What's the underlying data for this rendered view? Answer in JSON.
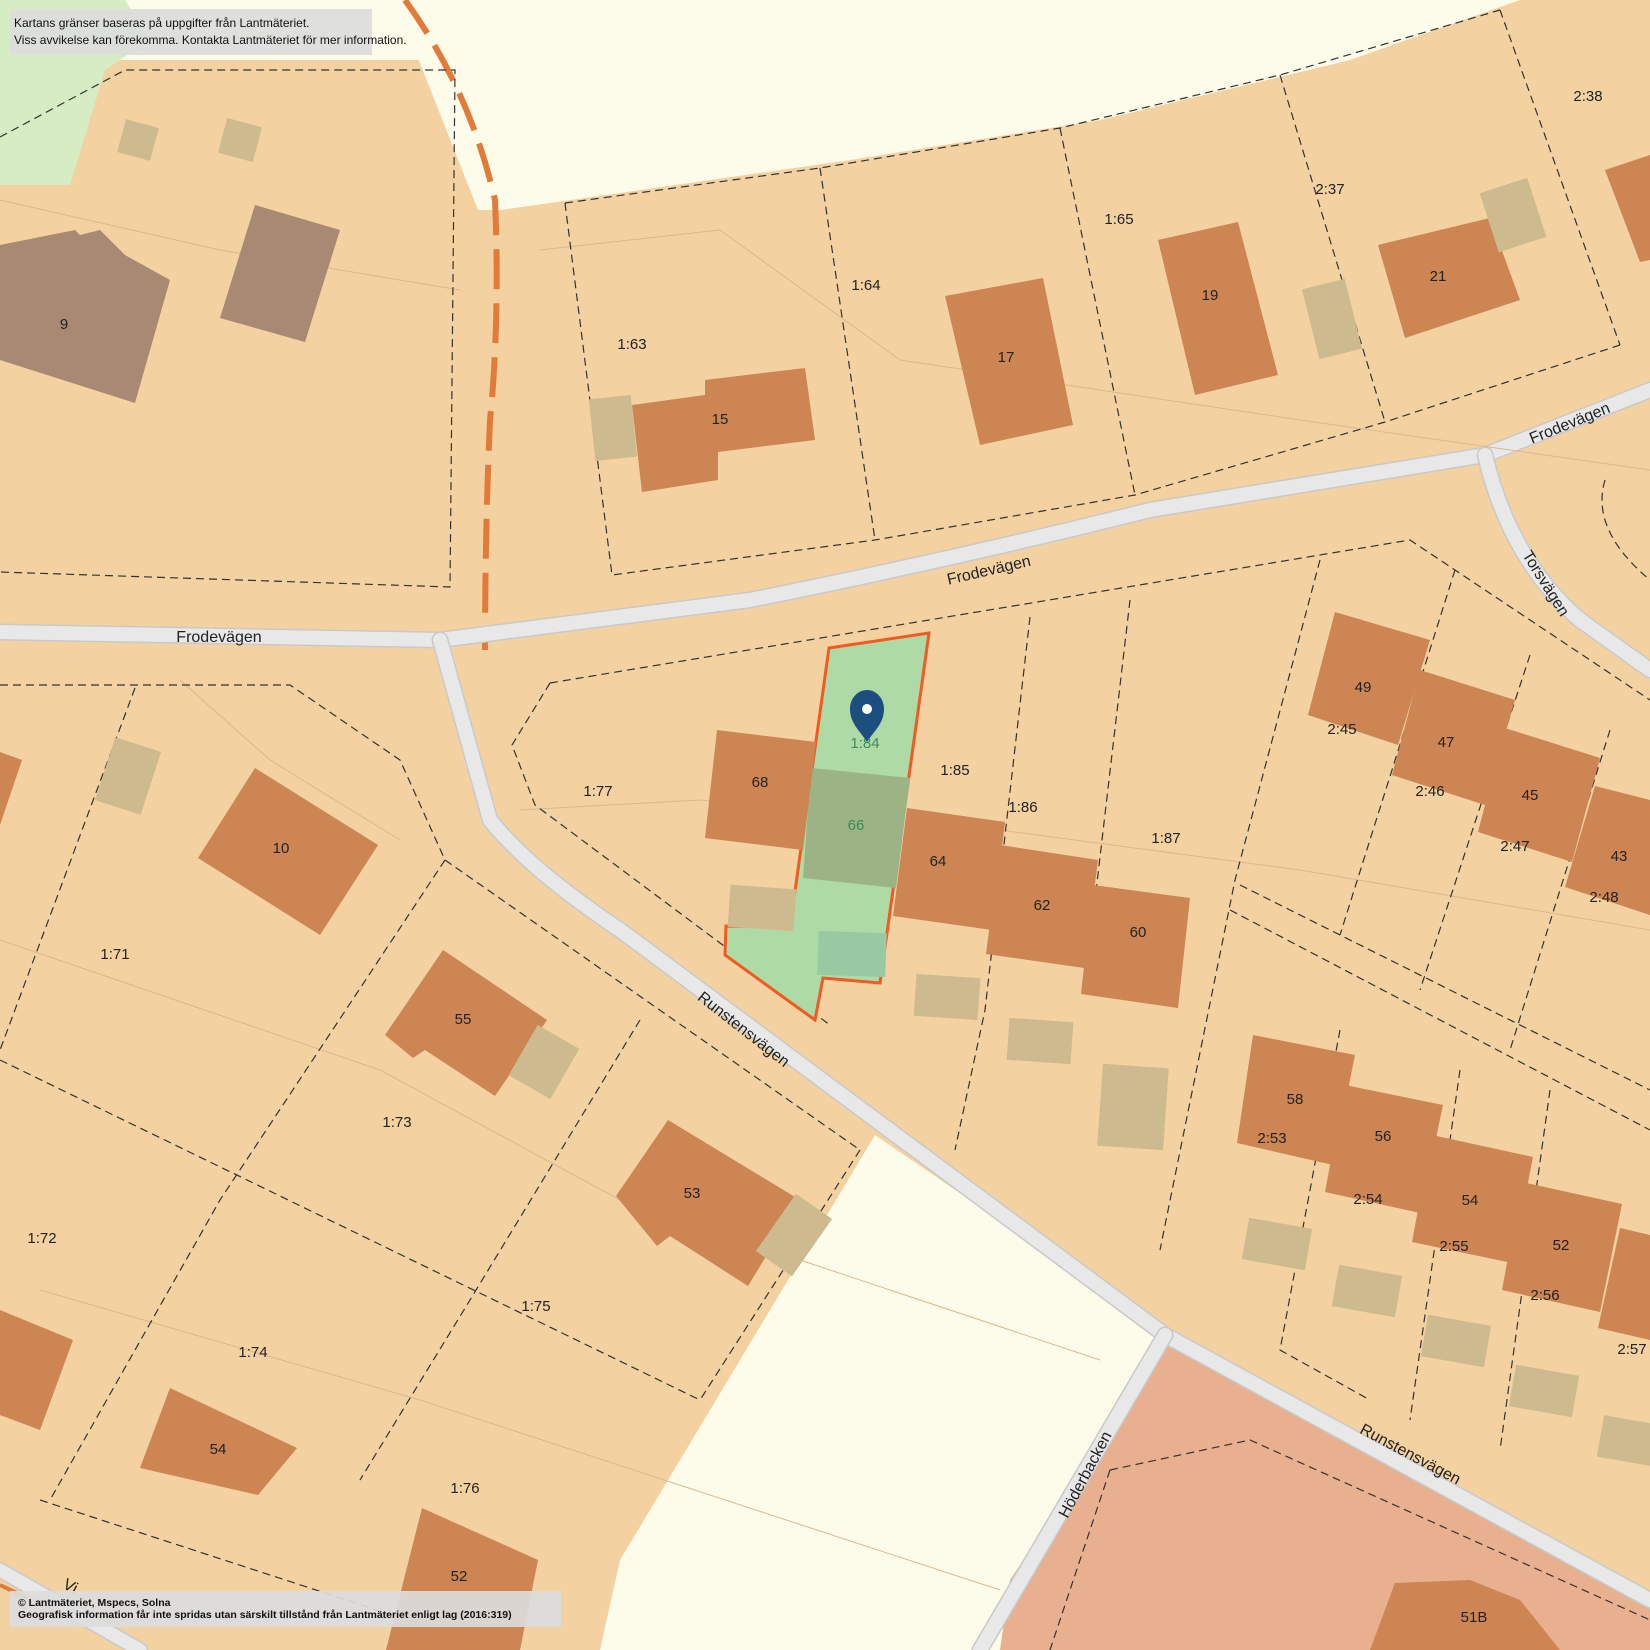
{
  "notices": {
    "top_line1": "Kartans gränser baseras på uppgifter från Lantmäteriet.",
    "top_line2": "Viss avvikelse kan förekomma. Kontakta Lantmäteriet för mer information.",
    "copyright_line1": "© Lantmäteriet, Mspecs, Solna",
    "copyright_line2": "Geografisk information får inte spridas utan särskilt tillstånd från Lantmäteriet enligt lag (2016:319)"
  },
  "streets": {
    "frodevagen_west": "Frodevägen",
    "frodevagen_mid": "Frodevägen",
    "frodevagen_east": "Frodevägen",
    "torsvagen": "Torsvägen",
    "runstensvagen_mid": "Runstensvägen",
    "runstensvagen_east": "Runstensvägen",
    "hoderbacken": "Höderbacken",
    "partial_street": "Vi"
  },
  "selected_parcel": {
    "parcel_id": "1:84",
    "house_number": "66",
    "highlight_color": "#f15a22",
    "marker_color": "#1c4e80",
    "marker_icon": "map-pin-icon"
  },
  "parcels": {
    "p_1_63": "1:63",
    "p_1_64": "1:64",
    "p_1_65": "1:65",
    "p_2_37": "2:37",
    "p_2_38": "2:38",
    "p_1_77": "1:77",
    "p_1_85": "1:85",
    "p_1_86": "1:86",
    "p_1_87": "1:87",
    "p_2_45": "2:45",
    "p_2_46": "2:46",
    "p_2_47": "2:47",
    "p_2_48": "2:48",
    "p_1_71": "1:71",
    "p_1_72": "1:72",
    "p_1_73": "1:73",
    "p_1_74": "1:74",
    "p_1_75": "1:75",
    "p_1_76": "1:76",
    "p_2_53": "2:53",
    "p_2_54": "2:54",
    "p_2_55": "2:55",
    "p_2_56": "2:56",
    "p_2_57": "2:57"
  },
  "houses": {
    "h9": "9",
    "h15": "15",
    "h17": "17",
    "h19": "19",
    "h21": "21",
    "h68": "68",
    "h64": "64",
    "h62": "62",
    "h60": "60",
    "h49": "49",
    "h47": "47",
    "h45": "45",
    "h43": "43",
    "h10": "10",
    "h55": "55",
    "h53": "53",
    "h54w": "54",
    "h52w": "52",
    "h58": "58",
    "h56": "56",
    "h54e": "54",
    "h52e": "52",
    "h51b": "51B"
  },
  "colors": {
    "residential": "#f3d1a1",
    "open_land": "#fdfbe9",
    "green_area": "#d6ecc2",
    "commercial": "#e8b08e",
    "building": "#cc8553",
    "outbuilding": "#cdbb8f",
    "road": "#e3e3e3",
    "municipal_boundary": "#e07b39"
  }
}
